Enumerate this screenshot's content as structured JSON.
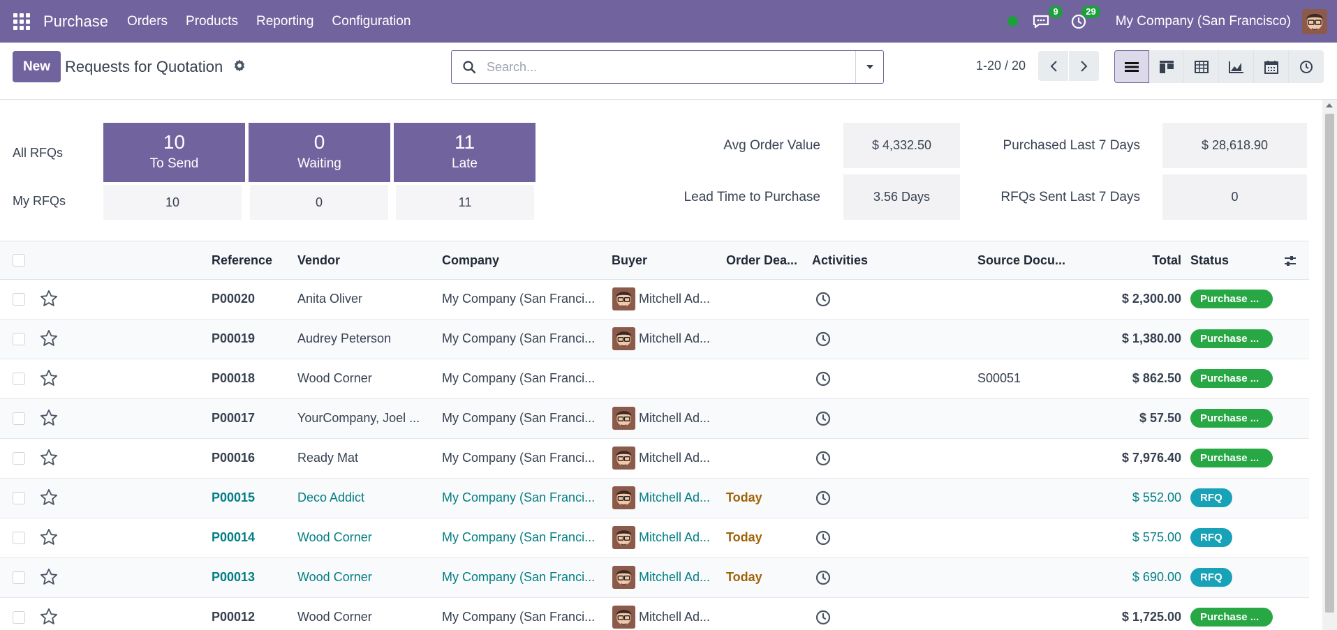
{
  "navbar": {
    "app_name": "Purchase",
    "menu": [
      "Orders",
      "Products",
      "Reporting",
      "Configuration"
    ],
    "messages_count": "9",
    "activities_count": "29",
    "company": "My Company (San Francisco)",
    "presence_color": "#1d9f3c"
  },
  "control": {
    "new_label": "New",
    "title": "Requests for Quotation",
    "search_placeholder": "Search...",
    "pager": "1-20 / 20",
    "views": [
      "list-view-icon",
      "kanban-view-icon",
      "pivot-view-icon",
      "graph-view-icon",
      "calendar-view-icon",
      "activity-view-icon"
    ]
  },
  "dashboard": {
    "all_label": "All RFQs",
    "my_label": "My RFQs",
    "tiles": [
      {
        "value": "10",
        "label": "To Send",
        "my": "10"
      },
      {
        "value": "0",
        "label": "Waiting",
        "my": "0"
      },
      {
        "value": "11",
        "label": "Late",
        "my": "11"
      }
    ],
    "kpis": {
      "avg_order_label": "Avg Order Value",
      "avg_order_value": "$ 4,332.50",
      "lead_time_label": "Lead Time to Purchase",
      "lead_time_value": "3.56 Days",
      "purchased_label": "Purchased Last 7 Days",
      "purchased_value": "$ 28,618.90",
      "rfqs_sent_label": "RFQs Sent Last 7 Days",
      "rfqs_sent_value": "0"
    }
  },
  "table": {
    "headers": {
      "reference": "Reference",
      "vendor": "Vendor",
      "company": "Company",
      "buyer": "Buyer",
      "deadline": "Order Dea...",
      "activities": "Activities",
      "source": "Source Docu...",
      "total": "Total",
      "status": "Status"
    },
    "rows": [
      {
        "ref": "P00020",
        "vendor": "Anita Oliver",
        "company": "My Company (San Franci...",
        "buyer": "Mitchell Ad...",
        "deadline": "",
        "source": "",
        "total": "$ 2,300.00",
        "status": "Purchase ...",
        "kind": "purchase"
      },
      {
        "ref": "P00019",
        "vendor": "Audrey Peterson",
        "company": "My Company (San Franci...",
        "buyer": "Mitchell Ad...",
        "deadline": "",
        "source": "",
        "total": "$ 1,380.00",
        "status": "Purchase ...",
        "kind": "purchase"
      },
      {
        "ref": "P00018",
        "vendor": "Wood Corner",
        "company": "My Company (San Franci...",
        "buyer": "",
        "deadline": "",
        "source": "S00051",
        "total": "$ 862.50",
        "status": "Purchase ...",
        "kind": "purchase"
      },
      {
        "ref": "P00017",
        "vendor": "YourCompany, Joel ...",
        "company": "My Company (San Franci...",
        "buyer": "Mitchell Ad...",
        "deadline": "",
        "source": "",
        "total": "$ 57.50",
        "status": "Purchase ...",
        "kind": "purchase"
      },
      {
        "ref": "P00016",
        "vendor": "Ready Mat",
        "company": "My Company (San Franci...",
        "buyer": "Mitchell Ad...",
        "deadline": "",
        "source": "",
        "total": "$ 7,976.40",
        "status": "Purchase ...",
        "kind": "purchase"
      },
      {
        "ref": "P00015",
        "vendor": "Deco Addict",
        "company": "My Company (San Franci...",
        "buyer": "Mitchell Ad...",
        "deadline": "Today",
        "source": "",
        "total": "$ 552.00",
        "status": "RFQ",
        "kind": "rfq"
      },
      {
        "ref": "P00014",
        "vendor": "Wood Corner",
        "company": "My Company (San Franci...",
        "buyer": "Mitchell Ad...",
        "deadline": "Today",
        "source": "",
        "total": "$ 575.00",
        "status": "RFQ",
        "kind": "rfq"
      },
      {
        "ref": "P00013",
        "vendor": "Wood Corner",
        "company": "My Company (San Franci...",
        "buyer": "Mitchell Ad...",
        "deadline": "Today",
        "source": "",
        "total": "$ 690.00",
        "status": "RFQ",
        "kind": "rfq"
      },
      {
        "ref": "P00012",
        "vendor": "Wood Corner",
        "company": "My Company (San Franci...",
        "buyer": "Mitchell Ad...",
        "deadline": "",
        "source": "",
        "total": "$ 1,725.00",
        "status": "Purchase ...",
        "kind": "purchase"
      }
    ]
  },
  "colors": {
    "brand": "#71639e",
    "purchase_status": "#28a745",
    "rfq_status": "#17a2b8",
    "rfq_text": "#017e84",
    "today_text": "#a16207"
  }
}
